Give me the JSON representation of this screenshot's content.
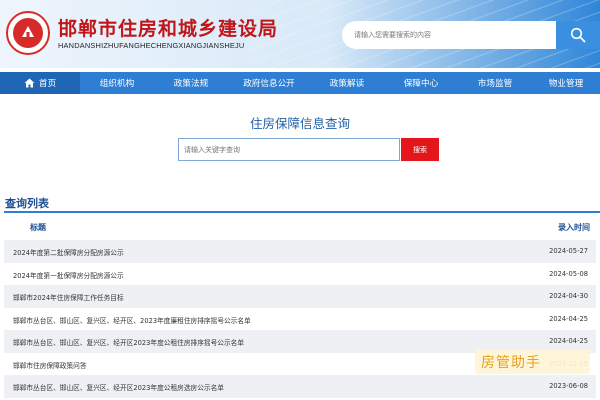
{
  "header": {
    "title": "邯郸市住房和城乡建设局",
    "subtitle": "HANDANSHIZHUFANGHECHENGXIANGJIANSHEJU",
    "search_placeholder": "请输入您需要搜索的内容",
    "search_icon": "search-icon",
    "logo_icon": "emblem-logo"
  },
  "nav": {
    "items": [
      {
        "label": "首页",
        "icon": "home-icon"
      },
      {
        "label": "组织机构"
      },
      {
        "label": "政策法规"
      },
      {
        "label": "政府信息公开"
      },
      {
        "label": "政策解读"
      },
      {
        "label": "保障中心"
      },
      {
        "label": "市场监管"
      },
      {
        "label": "物业管理"
      }
    ]
  },
  "query": {
    "title": "住房保障信息查询",
    "placeholder": "请输入关键字查询",
    "button": "搜索"
  },
  "list": {
    "heading": "查询列表",
    "col_title": "标题",
    "col_date": "录入时间",
    "rows": [
      {
        "title": "2024年度第二批保障房分配房源公示",
        "date": "2024-05-27"
      },
      {
        "title": "2024年度第一批保障房分配房源公示",
        "date": "2024-05-08"
      },
      {
        "title": "邯郸市2024年住房保障工作任务目标",
        "date": "2024-04-30"
      },
      {
        "title": "邯郸市丛台区、邯山区、复兴区、经开区、2023年度廉租住房排序摇号公示名单",
        "date": "2024-04-25"
      },
      {
        "title": "邯郸市丛台区、邯山区、复兴区、经开区2023年度公租住房排序摇号公示名单",
        "date": "2024-04-25"
      },
      {
        "title": "邯郸市住房保障政策问答",
        "date": "2023-12-15"
      },
      {
        "title": "邯郸市丛台区、邯山区、复兴区、经开区2023年度公租房选房公示名单",
        "date": "2023-06-08"
      }
    ]
  },
  "watermark": {
    "text": "房管助手"
  },
  "colors": {
    "nav": "#2e7fd4",
    "nav_active": "#1f66b5",
    "title_red": "#c0161a",
    "button_red": "#e4161c",
    "heading_blue": "#1f4f93"
  }
}
